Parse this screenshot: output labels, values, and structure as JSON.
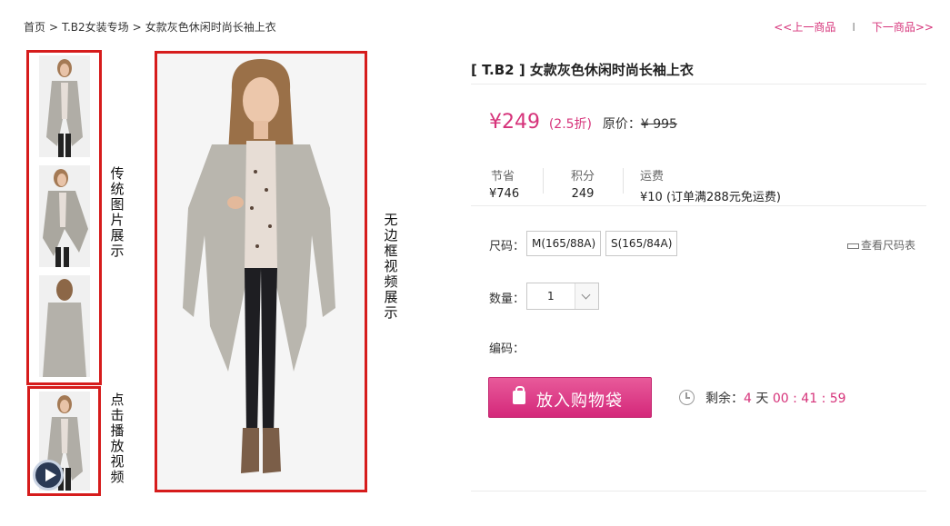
{
  "breadcrumb": {
    "home": "首页",
    "category": "T.B2女装专场",
    "current": "女款灰色休闲时尚长袖上衣",
    "separator": ">"
  },
  "nav": {
    "prev": "<<上一商品",
    "divider": "I",
    "next": "下一商品>>"
  },
  "gallery": {
    "thumb_label": "传统图片展示",
    "video_label": "点击播放视频",
    "main_label": "无边框视频展示"
  },
  "product": {
    "title": "[ T.B2 ] 女款灰色休闲时尚长袖上衣",
    "price": "¥249",
    "discount": "(2.5折)",
    "original_label": "原价：",
    "original_price": "¥ 995",
    "stats": [
      {
        "label": "节省",
        "value": "¥746"
      },
      {
        "label": "积分",
        "value": "249"
      },
      {
        "label": "运费",
        "value": "¥10 (订单满288元免运费)"
      }
    ],
    "size_label": "尺码：",
    "sizes": [
      "M(165/88A)",
      "S(165/84A)"
    ],
    "size_guide": "查看尺码表",
    "qty_label": "数量：",
    "qty_value": "1",
    "code_label": "编码：",
    "add_to_cart": "放入购物袋",
    "countdown": {
      "label": "剩余：",
      "days": "4",
      "day_unit": "天",
      "hours": "00",
      "minutes": "41",
      "seconds": "59",
      "colon": ":"
    }
  },
  "colors": {
    "accent": "#d6337a",
    "frame": "#d61c1c"
  }
}
